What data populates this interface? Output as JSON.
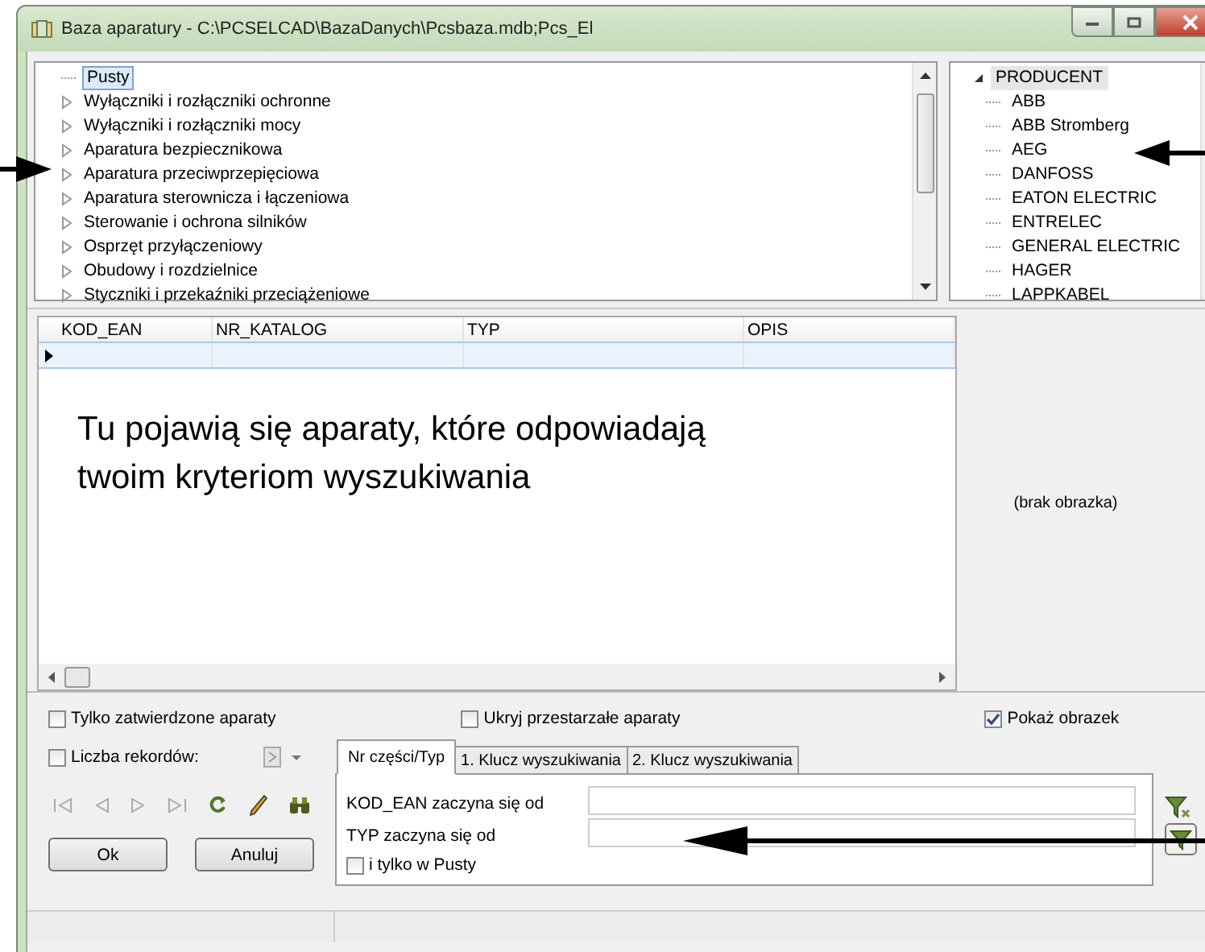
{
  "window": {
    "title": "Baza aparatury - C:\\PCSELCAD\\BazaDanych\\Pcsbaza.mdb;Pcs_El"
  },
  "category_tree": {
    "items": [
      {
        "label": "Pusty",
        "kind": "leaf",
        "selected": true
      },
      {
        "label": "Wyłączniki i rozłączniki ochronne",
        "kind": "folder",
        "selected": false
      },
      {
        "label": "Wyłączniki i rozłączniki mocy",
        "kind": "folder",
        "selected": false
      },
      {
        "label": "Aparatura bezpiecznikowa",
        "kind": "folder",
        "selected": false
      },
      {
        "label": "Aparatura przeciwprzepięciowa",
        "kind": "folder",
        "selected": false
      },
      {
        "label": "Aparatura sterownicza i łączeniowa",
        "kind": "folder",
        "selected": false
      },
      {
        "label": "Sterowanie i ochrona silników",
        "kind": "folder",
        "selected": false
      },
      {
        "label": "Osprzęt przyłączeniowy",
        "kind": "folder",
        "selected": false
      },
      {
        "label": "Obudowy i rozdzielnice",
        "kind": "folder",
        "selected": false
      },
      {
        "label": "Styczniki i przekaźniki przeciążeniowe",
        "kind": "folder",
        "selected": false
      }
    ]
  },
  "producer_tree": {
    "label": "PRODUCENT",
    "expanded": true,
    "selected": true,
    "children": [
      {
        "label": "ABB"
      },
      {
        "label": "ABB Stromberg"
      },
      {
        "label": "AEG"
      },
      {
        "label": "DANFOSS"
      },
      {
        "label": "EATON ELECTRIC"
      },
      {
        "label": "ENTRELEC"
      },
      {
        "label": "GENERAL ELECTRIC"
      },
      {
        "label": "HAGER"
      },
      {
        "label": "LAPPKABEL"
      }
    ]
  },
  "grid": {
    "columns": [
      "KOD_EAN",
      "NR_KATALOG",
      "TYP",
      "OPIS"
    ],
    "hint": "Tu pojawią się aparaty, które odpowiadają twoim kryteriom wyszukiwania"
  },
  "image_panel": {
    "text": "(brak obrazka)"
  },
  "options": [
    {
      "label": "Tylko zatwierdzone aparaty",
      "checked": false
    },
    {
      "label": "Ukryj przestarzałe aparaty",
      "checked": false
    },
    {
      "label": "Pokaż obrazek",
      "checked": true
    }
  ],
  "record_count": {
    "label": "Liczba rekordów:",
    "checked": false
  },
  "tabs": [
    {
      "label": "Nr części/Typ",
      "selected": true
    },
    {
      "label": "1. Klucz wyszukiwania",
      "selected": false
    },
    {
      "label": "2. Klucz wyszukiwania",
      "selected": false
    }
  ],
  "search_fields": [
    {
      "label": "KOD_EAN zaczyna się od"
    },
    {
      "label": "TYP zaczyna się od"
    }
  ],
  "only_in": {
    "label": "i tylko w Pusty",
    "checked": false
  },
  "buttons": [
    "Ok",
    "Anuluj"
  ]
}
